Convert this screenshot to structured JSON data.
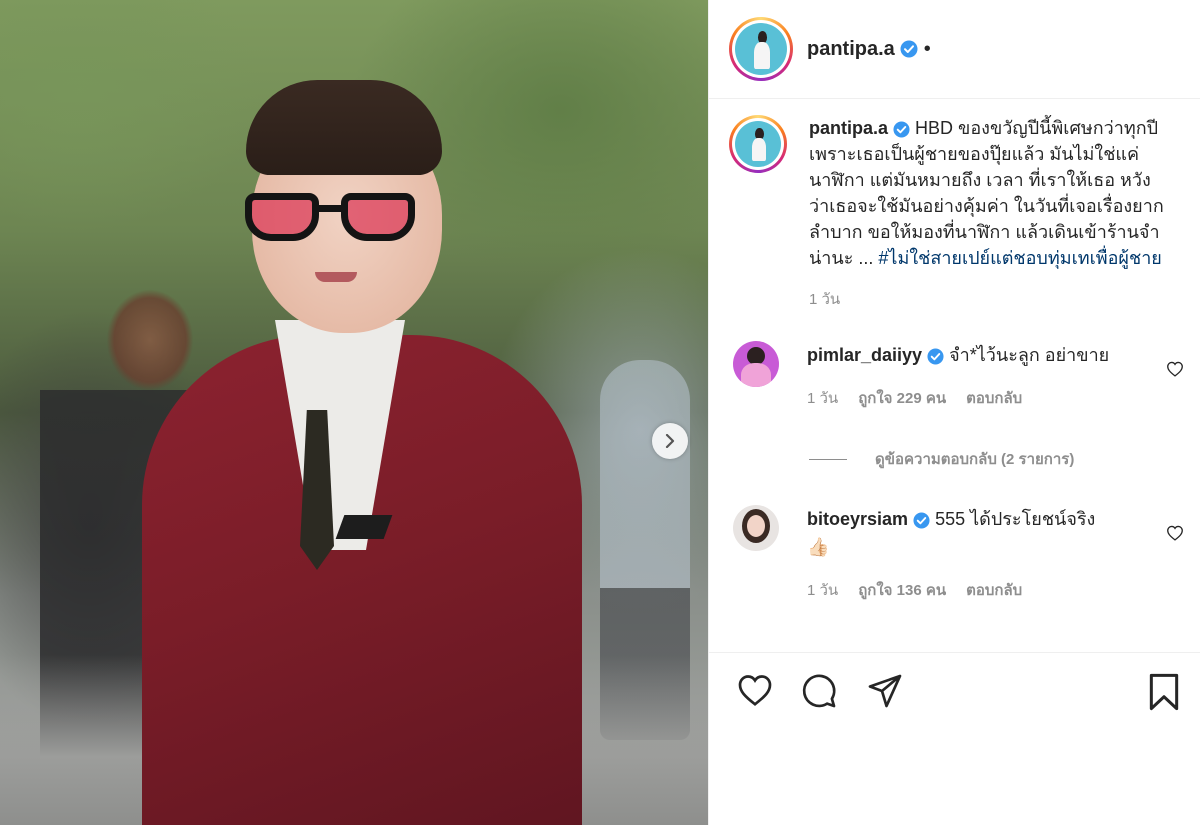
{
  "post": {
    "username": "pantipa.a",
    "header_separator": "•",
    "caption_text": "HBD ของขวัญปีนี้พิเศษกว่าทุกปีเพราะเธอเป็นผู้ชายของปุ๊ยแล้ว มันไม่ใช่แค่นาฬิกา แต่มันหมายถึง เวลา ที่เราให้เธอ หวังว่าเธอจะใช้มันอย่างคุ้มค่า ในวันที่เจอเรื่องยากลำบาก ขอให้มองที่นาฬิกา แล้วเดินเข้าร้านจำน่านะ ...",
    "hashtag": "#ไม่ใช่สายเปย์แต่ชอบทุ่มเทเพื่อผู้ชาย",
    "time_ago": "1 วัน"
  },
  "comments": [
    {
      "username": "pimlar_daiiyy",
      "text": "จำ*ไว้นะลูก อย่าขาย",
      "time_ago": "1 วัน",
      "likes": "ถูกใจ 229 คน",
      "reply_label": "ตอบกลับ",
      "avatar_color": "#c85bd6"
    },
    {
      "username": "bitoeyrsiam",
      "text": "555 ได้ประโยชน์จริง",
      "emoji": "👍🏻",
      "time_ago": "1 วัน",
      "likes": "ถูกใจ 136 คน",
      "reply_label": "ตอบกลับ",
      "avatar_color": "#e8e4e2"
    }
  ],
  "view_replies_label": "ดูข้อความตอบกลับ (2 รายการ)",
  "colors": {
    "verified": "#3897f0",
    "hashtag": "#00376b",
    "muted": "#8e8e8e",
    "text": "#262626"
  },
  "icons": [
    "verified-badge-icon",
    "chevron-right-icon",
    "heart-icon",
    "comment-icon",
    "share-icon",
    "bookmark-icon"
  ]
}
